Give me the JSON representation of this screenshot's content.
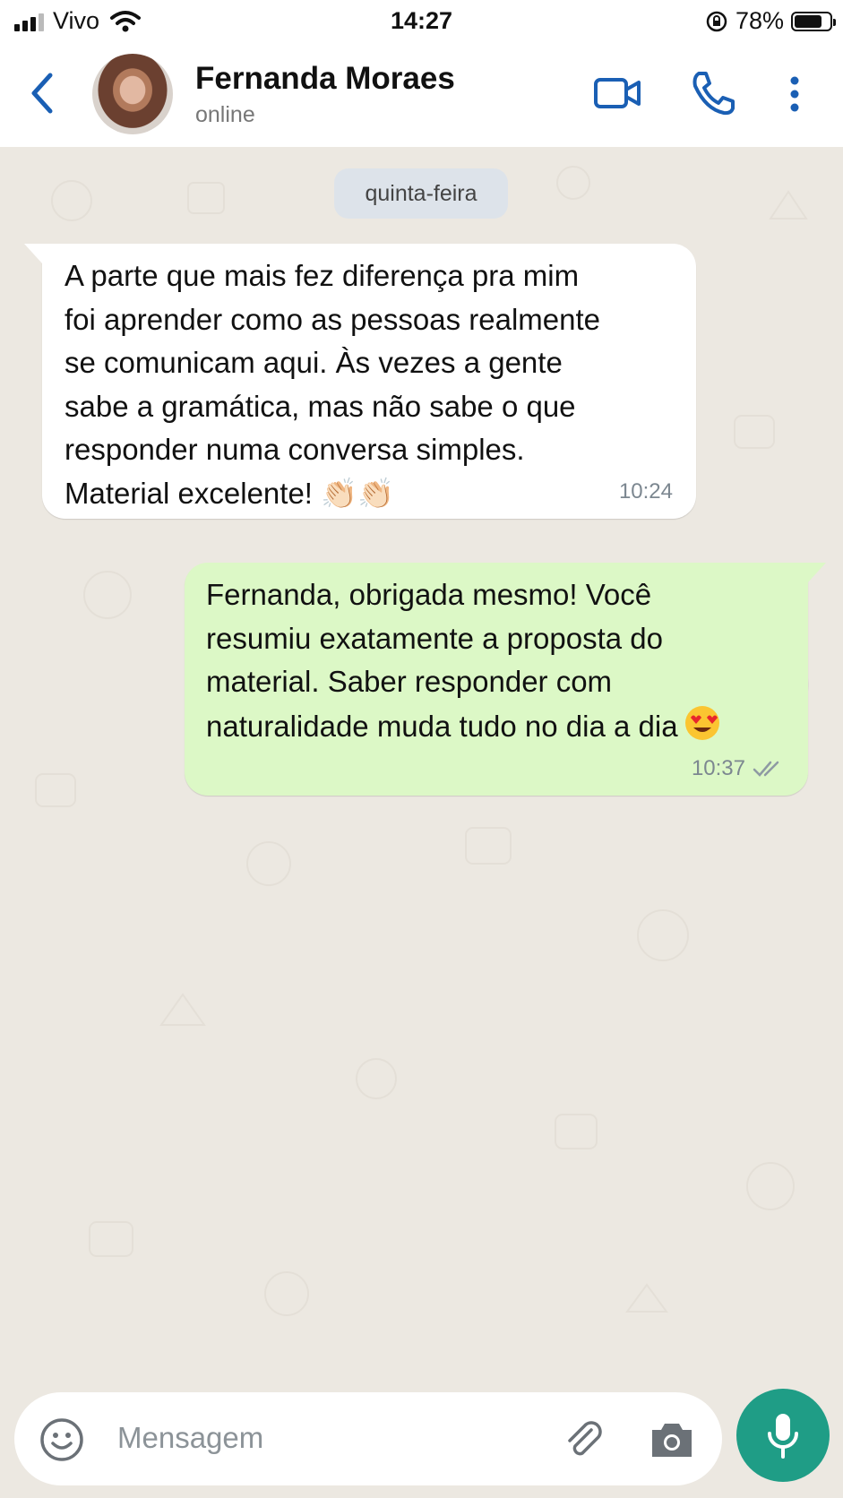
{
  "status_bar": {
    "carrier": "Vivo",
    "time": "14:27",
    "battery_percent": "78%",
    "battery_level": 0.78,
    "signal_bars": 3
  },
  "header": {
    "contact_name": "Fernanda Moraes",
    "contact_status": "online",
    "icons": [
      "back-arrow-icon",
      "video-call-icon",
      "phone-icon",
      "more-vertical-icon"
    ]
  },
  "chat": {
    "date_label": "quinta-feira",
    "messages": [
      {
        "direction": "incoming",
        "text": "A parte que mais fez diferença pra mim\nfoi aprender como as pessoas realmente\nse comunicam aqui. Às vezes a gente\nsabe a gramática, mas não sabe o que\nresponder numa conversa simples.\nMaterial excelente! 👏🏻👏🏻",
        "time": "10:24"
      },
      {
        "direction": "outgoing",
        "text": "Fernanda, obrigada mesmo! Você\nresumiu exatamente a proposta do\nmaterial. Saber responder com\nnaturalidade muda tudo no dia a dia",
        "emoji": "heart-eyes-emoji",
        "time": "10:37",
        "status": "read"
      }
    ]
  },
  "input_bar": {
    "placeholder": "Mensagem",
    "icons": [
      "emoji-icon",
      "attachment-icon",
      "camera-icon",
      "microphone-icon"
    ]
  },
  "colors": {
    "chat_background": "#ece8e1",
    "outgoing_bubble": "#dcf8c6",
    "incoming_bubble": "#ffffff",
    "accent": "#1a5fb4",
    "mic_button": "#1f9d86"
  }
}
